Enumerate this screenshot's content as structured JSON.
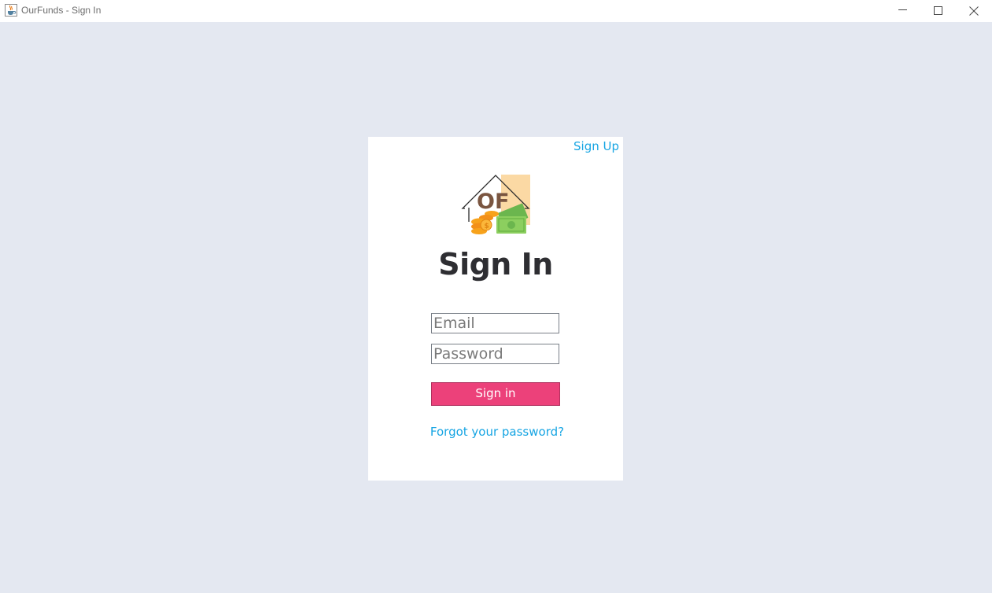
{
  "window": {
    "title": "OurFunds - Sign In",
    "icon": "java-cup-icon",
    "controls": [
      "minimize-icon",
      "maximize-icon",
      "close-icon"
    ]
  },
  "signin": {
    "signup_link": "Sign Up",
    "logo_text": "OF",
    "heading": "Sign In",
    "email_placeholder": "Email",
    "password_placeholder": "Password",
    "email_value": "",
    "password_value": "",
    "submit_label": "Sign in",
    "forgot_link": "Forgot your password?"
  },
  "colors": {
    "background": "#e4e8f1",
    "card": "#ffffff",
    "link": "#17a5e3",
    "button": "#ec417a",
    "heading": "#2e2e32"
  }
}
